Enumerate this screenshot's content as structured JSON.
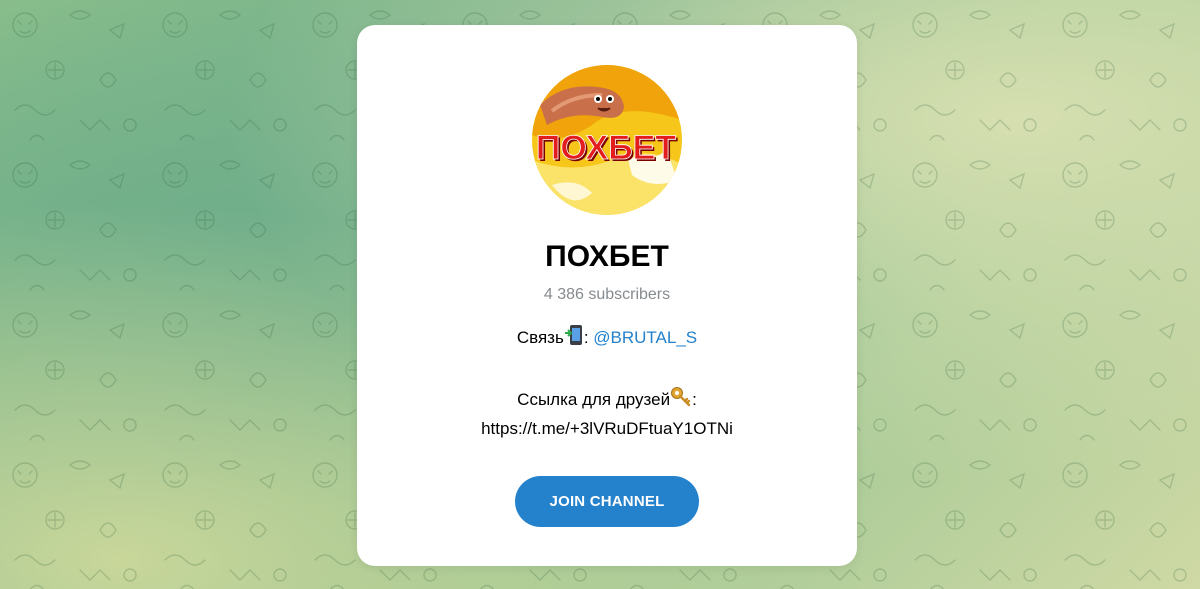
{
  "channel": {
    "name": "ПОХБЕТ",
    "subscribers": "4 386 subscribers",
    "avatar_text": "ПОХБЕТ",
    "contact_prefix": "Связь",
    "contact_sep": ": ",
    "contact_handle": "@BRUTAL_S",
    "friends_label": "Ссылка для друзей",
    "friends_colon": ":",
    "invite_link": "https://t.me/+3lVRuDFtuaY1OTNi"
  },
  "actions": {
    "join_label": "JOIN CHANNEL"
  },
  "icons": {
    "phone": "mobile-phone-arrow-icon",
    "key": "key-icon"
  },
  "colors": {
    "accent": "#2481cc",
    "subtle_text": "#868b8f",
    "card_bg": "#ffffff"
  }
}
